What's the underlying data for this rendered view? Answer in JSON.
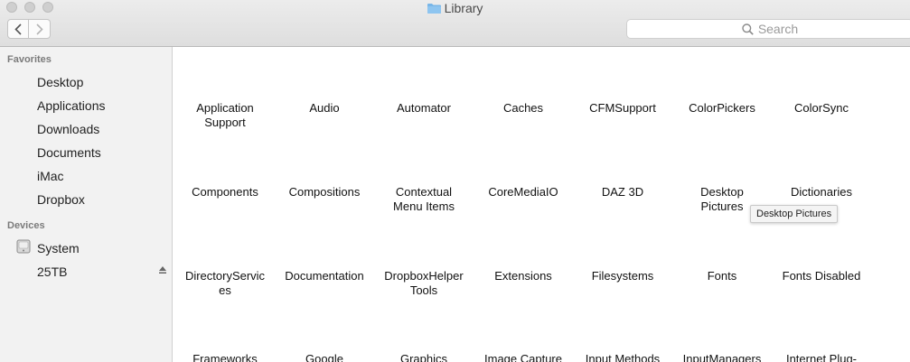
{
  "window": {
    "title": "Library"
  },
  "toolbar": {
    "search_placeholder": "Search"
  },
  "sidebar": {
    "favorites_heading": "Favorites",
    "favorites": [
      "Desktop",
      "Applications",
      "Downloads",
      "Documents",
      "iMac",
      "Dropbox"
    ],
    "devices_heading": "Devices",
    "devices": [
      "System",
      "25TB"
    ]
  },
  "grid": {
    "row1": [
      "Application\nSupport",
      "Audio",
      "Automator",
      "Caches",
      "CFMSupport",
      "ColorPickers",
      "ColorSync"
    ],
    "row2": [
      "Components",
      "Compositions",
      "Contextual\nMenu Items",
      "CoreMediaIO",
      "DAZ 3D",
      "Desktop\nPictures",
      "Dictionaries"
    ],
    "row3": [
      "DirectoryServic\nes",
      "Documentation",
      "DropboxHelper\nTools",
      "Extensions",
      "Filesystems",
      "Fonts",
      "Fonts Disabled"
    ],
    "row4": [
      "Frameworks",
      "Google",
      "Graphics",
      "Image Capture",
      "Input Methods",
      "InputManagers",
      "Internet Plug-"
    ]
  },
  "tooltip": "Desktop Pictures",
  "colors": {
    "toolbar": "#e4e4e4",
    "sidebar": "#f2f2f2",
    "folder": "#78b6e8"
  }
}
